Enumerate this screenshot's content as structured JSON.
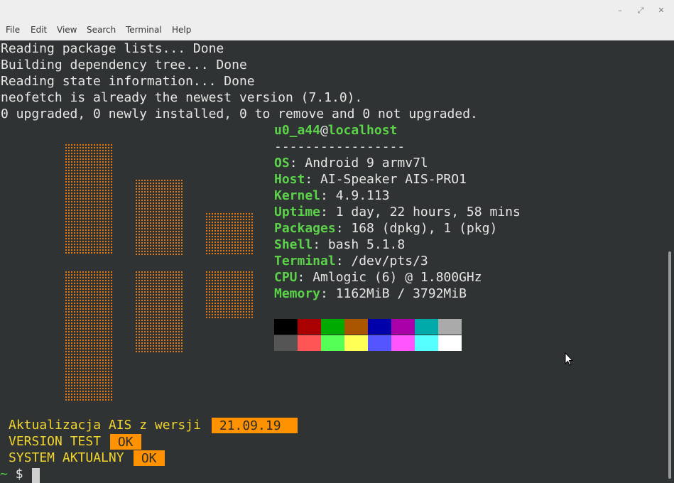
{
  "window": {
    "minimize": "–",
    "maximize": "⤢",
    "close": "✕"
  },
  "menu": [
    "File",
    "Edit",
    "View",
    "Search",
    "Terminal",
    "Help"
  ],
  "output": [
    "Reading package lists... Done",
    "Building dependency tree... Done",
    "Reading state information... Done",
    "neofetch is already the newest version (7.1.0).",
    "0 upgraded, 0 newly installed, 0 to remove and 0 not upgraded."
  ],
  "neofetch": {
    "user": "u0_a44",
    "at": "@",
    "host": "localhost",
    "separator": "-----------------",
    "info": [
      {
        "label": "OS",
        "value": ": Android 9 armv7l"
      },
      {
        "label": "Host",
        "value": ": AI-Speaker AIS-PRO1"
      },
      {
        "label": "Kernel",
        "value": ": 4.9.113"
      },
      {
        "label": "Uptime",
        "value": ": 1 day, 22 hours, 58 mins"
      },
      {
        "label": "Packages",
        "value": ": 168 (dpkg), 1 (pkg)"
      },
      {
        "label": "Shell",
        "value": ": bash 5.1.8"
      },
      {
        "label": "Terminal",
        "value": ": /dev/pts/3"
      },
      {
        "label": "CPU",
        "value": ": Amlogic (6) @ 1.800GHz"
      },
      {
        "label": "Memory",
        "value": ": 1162MiB / 3792MiB"
      }
    ],
    "palette_top": [
      "#000000",
      "#aa0000",
      "#00aa00",
      "#aa5500",
      "#0000aa",
      "#aa00aa",
      "#00aaaa",
      "#aaaaaa"
    ],
    "palette_bottom": [
      "#555555",
      "#ff5555",
      "#55ff55",
      "#ffff55",
      "#5555ff",
      "#ff55ff",
      "#55ffff",
      "#ffffff"
    ],
    "logo_color": "#e07a10"
  },
  "ais": {
    "update_label": "Aktualizacja AIS z wersji",
    "update_version": " 21.09.19 ",
    "test_label": "VERSION TEST",
    "test_status": " OK ",
    "system_label": "SYSTEM AKTUALNY",
    "system_status": " OK "
  },
  "prompt": {
    "tilde": "~",
    "dollar": " $ "
  }
}
